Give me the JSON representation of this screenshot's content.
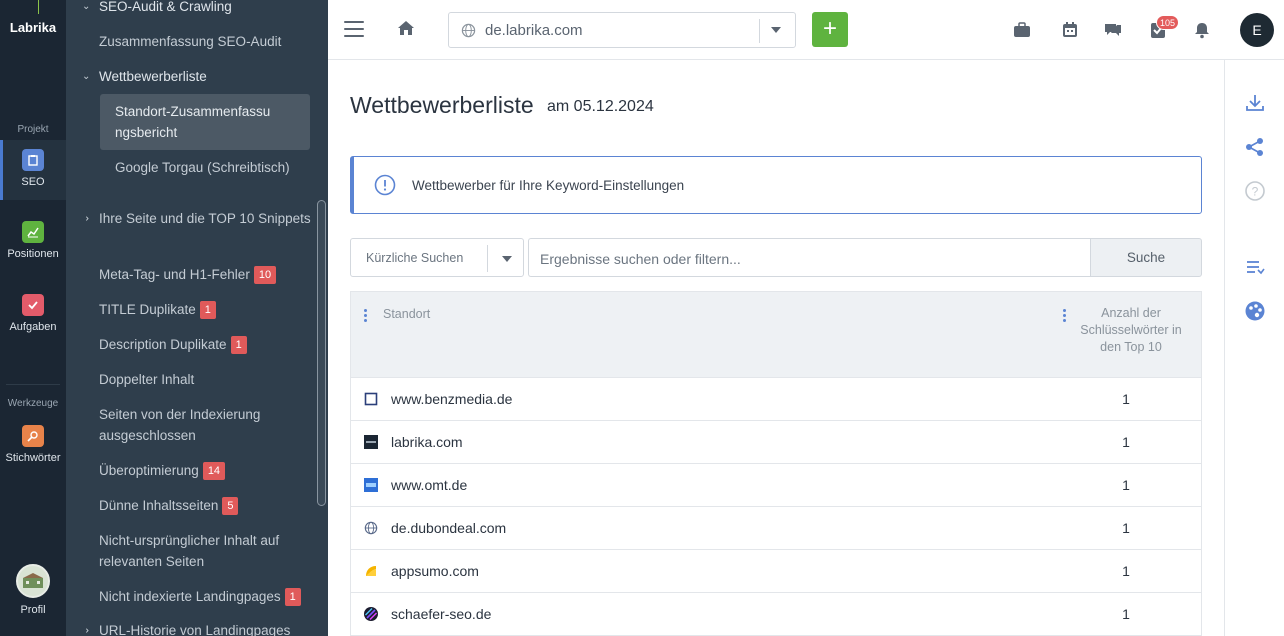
{
  "rail": {
    "logo": "Labrika",
    "section_project": "Projekt",
    "section_tools": "Werkzeuge",
    "items": [
      {
        "label": "SEO",
        "icon": "seo-icon",
        "color": "#5b84d3"
      },
      {
        "label": "Positionen",
        "icon": "positions-chart-icon",
        "color": "#5fb33f"
      },
      {
        "label": "Aufgaben",
        "icon": "tasks-check-icon",
        "color": "#e35b6a"
      },
      {
        "label": "Stichwörter",
        "icon": "keywords-icon",
        "color": "#e8834a"
      }
    ],
    "profile_label": "Profil"
  },
  "sidebar": {
    "rows": [
      {
        "label": "SEO-Audit & Crawling",
        "chevron": true
      },
      {
        "label": "Zusammenfassung SEO-Audit"
      },
      {
        "label": "Wettbewerberliste",
        "chevron": true
      },
      {
        "label": "Standort-Zusammenfassungsbericht",
        "active": true
      },
      {
        "label": "Google Torgau (Schreibtisch)"
      },
      {
        "label": "Ihre Seite und die TOP 10 Snippets",
        "chevron": true
      },
      {
        "label": "Meta-Tag- und H1-Fehler",
        "badge": "10"
      },
      {
        "label": "TITLE Duplikate",
        "badge": "1"
      },
      {
        "label": "Description Duplikate",
        "badge": "1"
      },
      {
        "label": "Doppelter Inhalt"
      },
      {
        "label": "Seiten von der Indexierung ausgeschlossen"
      },
      {
        "label": "Überoptimierung",
        "badge": "14"
      },
      {
        "label": "Dünne Inhaltsseiten",
        "badge": "5"
      },
      {
        "label": "Nicht-ursprünglicher Inhalt auf relevanten Seiten"
      },
      {
        "label": "Nicht indexierte Landingpages",
        "badge": "1"
      },
      {
        "label": "URL-Historie von Landingpages",
        "chevron": true
      }
    ]
  },
  "topbar": {
    "domain": "de.labrika.com",
    "add_label": "+",
    "notifications_count": "105",
    "user_initial": "E"
  },
  "main": {
    "title": "Wettbewerberliste",
    "date": "am 05.12.2024",
    "info": "Wettbewerber für Ihre Keyword-Einstellungen",
    "recent_searches": "Kürzliche Suchen",
    "search_placeholder": "Ergebnisse suchen oder filtern...",
    "search_button": "Suche",
    "table": {
      "col_location": "Standort",
      "col_count": "Anzahl der Schlüsselwörter in den Top 10",
      "rows": [
        {
          "domain": "www.benzmedia.de",
          "count": "1",
          "favicon": "square-outline-icon"
        },
        {
          "domain": "labrika.com",
          "count": "1",
          "favicon": "labrika-favicon-icon"
        },
        {
          "domain": "www.omt.de",
          "count": "1",
          "favicon": "omt-favicon-icon"
        },
        {
          "domain": "de.dubondeal.com",
          "count": "1",
          "favicon": "globe-favicon-icon"
        },
        {
          "domain": "appsumo.com",
          "count": "1",
          "favicon": "appsumo-favicon-icon"
        },
        {
          "domain": "schaefer-seo.de",
          "count": "1",
          "favicon": "schaefer-favicon-icon"
        }
      ]
    }
  }
}
